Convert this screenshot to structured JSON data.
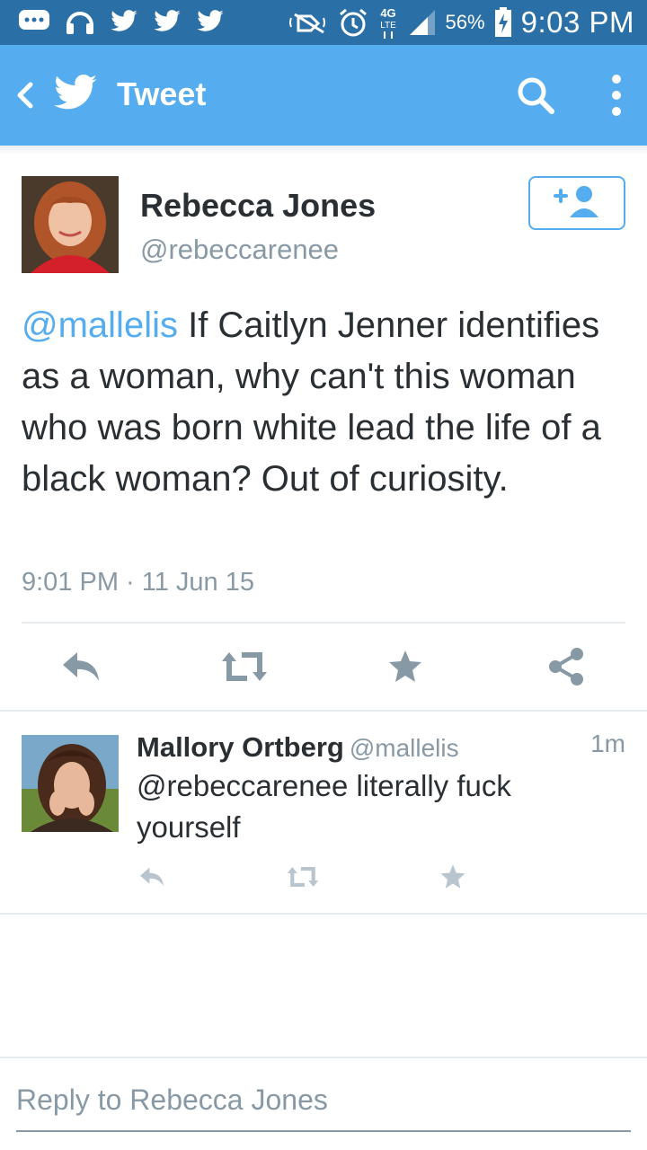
{
  "status_bar": {
    "battery": "56%",
    "time": "9:03 PM",
    "network": "4G LTE"
  },
  "app_bar": {
    "title": "Tweet"
  },
  "tweet": {
    "author_name": "Rebecca Jones",
    "author_handle": "@rebeccarenee",
    "mention": "@mallelis",
    "body": " If Caitlyn Jenner identifies as a woman, why can't this woman who was born white lead the life of a black woman? Out of curiosity.",
    "timestamp": "9:01 PM · 11 Jun 15"
  },
  "reply": {
    "author_name": "Mallory Ortberg",
    "author_handle": "@mallelis",
    "time_ago": "1m",
    "body": "@rebeccarenee literally fuck yourself"
  },
  "composer": {
    "placeholder": "Reply to Rebecca Jones"
  },
  "colors": {
    "status_bar": "#2a6fa6",
    "app_bar": "#55acee",
    "text": "#292f33",
    "muted": "#8899a6",
    "link": "#55acee"
  }
}
